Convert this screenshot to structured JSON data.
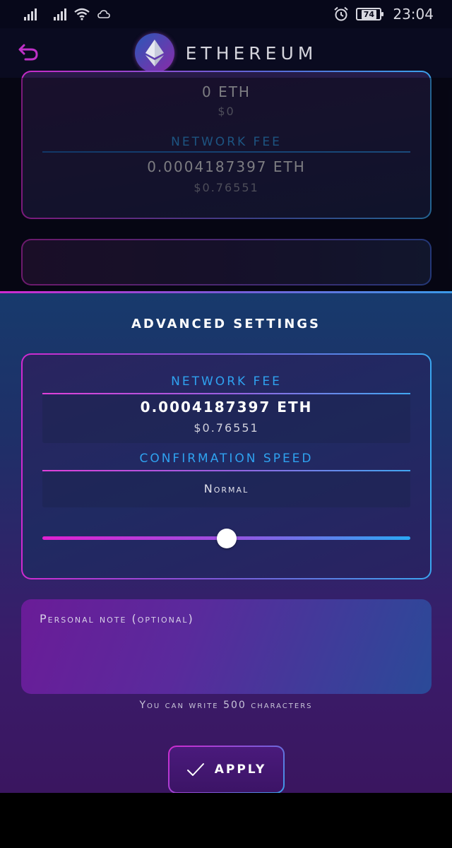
{
  "status_bar": {
    "time": "23:04",
    "battery": "74",
    "icons": [
      "signal-icon",
      "signal-icon",
      "wifi-icon",
      "cloud-icon",
      "alarm-icon",
      "battery-icon"
    ]
  },
  "header": {
    "title": "ETHEREUM",
    "back_icon": "back-arrow-icon",
    "logo_icon": "ethereum-logo-icon"
  },
  "summary_card": {
    "amount_eth": "0 ETH",
    "amount_usd": "$0",
    "fee_label": "NETWORK FEE",
    "fee_eth": "0.0004187397 ETH",
    "fee_usd": "$0.76551"
  },
  "advanced": {
    "title": "ADVANCED SETTINGS",
    "fee_label": "NETWORK FEE",
    "fee_eth": "0.0004187397 ETH",
    "fee_usd": "$0.76551",
    "speed_label": "CONFIRMATION SPEED",
    "speed_value": "Normal",
    "speed_level": 0.5
  },
  "note": {
    "placeholder": "Personal note (optional)",
    "hint": "You can write 500 characters"
  },
  "apply": {
    "label": "APPLY",
    "icon": "check-icon"
  },
  "colors": {
    "accent_pink": "#d02ad0",
    "accent_blue": "#3aa0ea",
    "label_blue": "#2fa2f0"
  }
}
